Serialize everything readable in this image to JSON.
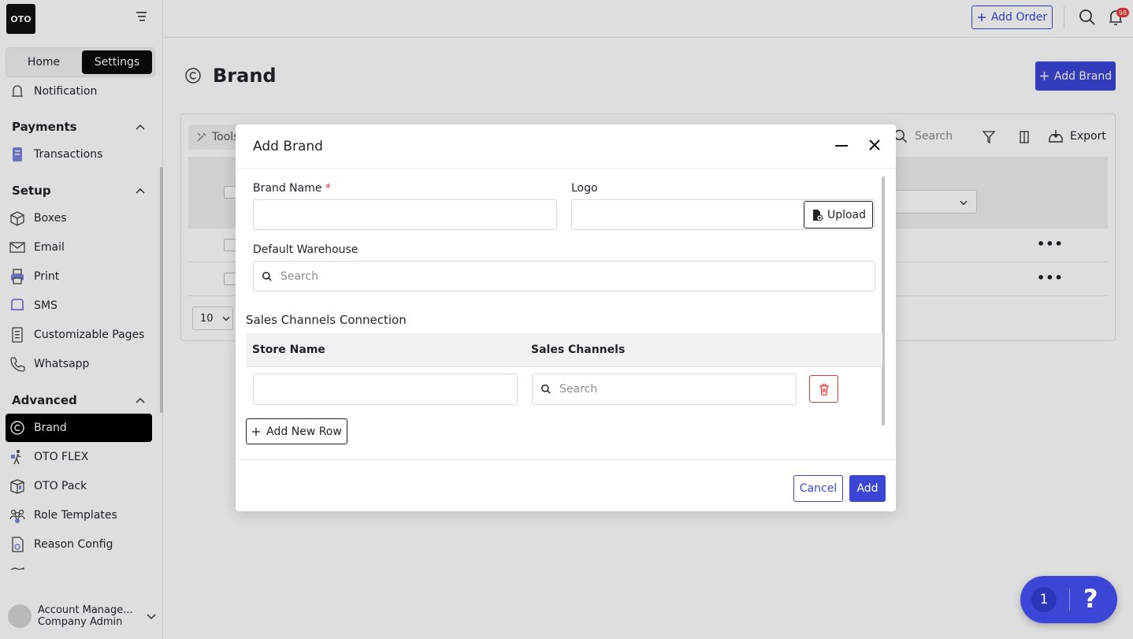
{
  "colors": {
    "accent": "#3b46d6",
    "danger": "#e53935",
    "sidebar_active": "#000000"
  },
  "sidebar": {
    "logo": "OTO",
    "tabs": [
      "Home",
      "Settings"
    ],
    "active_tab": "Settings",
    "items": {
      "notification": "Notification",
      "payments": "Payments",
      "transactions": "Transactions",
      "setup": "Setup",
      "boxes": "Boxes",
      "email": "Email",
      "print": "Print",
      "sms": "SMS",
      "customizable_pages": "Customizable Pages",
      "whatsapp": "Whatsapp",
      "advanced": "Advanced",
      "brand": "Brand",
      "oto_flex": "OTO FLEX",
      "oto_pack": "OTO Pack",
      "role_templates": "Role Templates",
      "reason_config": "Reason Config"
    },
    "user": {
      "name": "Account Manage...",
      "role": "Company Admin"
    }
  },
  "topbar": {
    "add_order": "Add Order",
    "notification_count": "98"
  },
  "page": {
    "title": "Brand",
    "add_brand": "Add Brand"
  },
  "background_table": {
    "tools": "Tools",
    "search_placeholder": "Search",
    "export": "Export",
    "page_size": "10",
    "row_action": "•••"
  },
  "modal": {
    "title": "Add Brand",
    "brand_name_label": "Brand Name",
    "required_mark": "*",
    "logo_label": "Logo",
    "upload": "Upload",
    "warehouse_label": "Default Warehouse",
    "warehouse_placeholder": "Search",
    "sales_section": "Sales Channels Connection",
    "col_store": "Store Name",
    "col_channels": "Sales Channels",
    "channels_placeholder": "Search",
    "add_row": "Add New Row",
    "cancel": "Cancel",
    "add": "Add"
  },
  "help_widget": {
    "count": "1",
    "symbol": "?"
  },
  "icons": [
    "collapse-icon",
    "bell-icon",
    "search-icon",
    "plus-icon",
    "copyright-icon",
    "filter-icon",
    "columns-icon",
    "export-icon",
    "minimize-icon",
    "close-icon",
    "upload-file-icon",
    "trash-icon",
    "chevron-up-icon",
    "chevron-down-icon"
  ]
}
